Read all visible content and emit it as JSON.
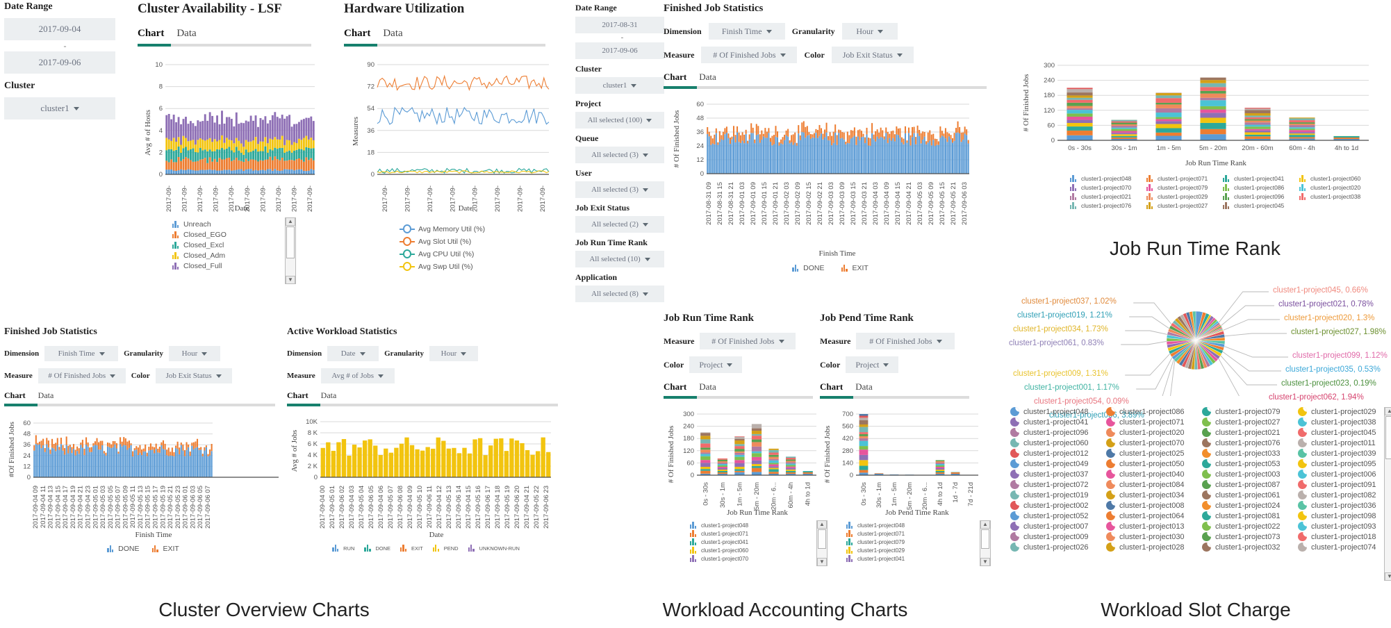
{
  "colors": {
    "accent": "#17806d",
    "blue": "#5b9bd5",
    "orange": "#ed7d31",
    "teal": "#2ca89a",
    "yellow": "#f2c40f",
    "purple": "#8e6fb5",
    "pink": "#e7559c",
    "control_bg": "#eceff1"
  },
  "cluster_overview": {
    "caption": "Cluster Overview Charts",
    "filters": {
      "date_range_label": "Date Range",
      "date_from": "2017-09-04",
      "date_sep": "-",
      "date_to": "2017-09-06",
      "cluster_label": "Cluster",
      "cluster_value": "cluster1"
    },
    "availability": {
      "title": "Cluster Availability - LSF",
      "tabs": [
        "Chart",
        "Data"
      ],
      "active_tab": "Chart",
      "legend": [
        "Unreach",
        "Closed_EGO",
        "Closed_Excl",
        "Closed_Adm",
        "Closed_Full"
      ]
    },
    "hardware": {
      "title": "Hardware Utilization",
      "tabs": [
        "Chart",
        "Data"
      ],
      "active_tab": "Chart",
      "legend": [
        "Avg Memory Util (%)",
        "Avg Slot Util (%)",
        "Avg CPU Util (%)",
        "Avg Swp Util (%)"
      ]
    },
    "finished_job_statistics": {
      "title": "Finished Job Statistics",
      "dimension_label": "Dimension",
      "dimension_value": "Finish Time",
      "granularity_label": "Granularity",
      "granularity_value": "Hour",
      "measure_label": "Measure",
      "measure_value": "# Of Finished Jobs",
      "color_label": "Color",
      "color_value": "Job Exit Status",
      "tabs": [
        "Chart",
        "Data"
      ],
      "active_tab": "Chart",
      "legend": [
        "DONE",
        "EXIT"
      ]
    },
    "active_workload_statistics": {
      "title": "Active Workload Statistics",
      "dimension_label": "Dimension",
      "dimension_value": "Date",
      "granularity_label": "Granularity",
      "granularity_value": "Hour",
      "measure_label": "Measure",
      "measure_value": "Avg # of Jobs",
      "tabs": [
        "Chart",
        "Data"
      ],
      "active_tab": "Chart",
      "legend": [
        "RUN",
        "DONE",
        "EXIT",
        "PEND",
        "UNKNOWN-RUN"
      ]
    }
  },
  "workload_accounting": {
    "caption": "Workload Accounting Charts",
    "filters": {
      "date_range_label": "Date Range",
      "date_from": "2017-08-31",
      "date_sep": "-",
      "date_to": "2017-09-06",
      "items": [
        {
          "label": "Cluster",
          "value": "cluster1"
        },
        {
          "label": "Project",
          "value": "All selected (100)"
        },
        {
          "label": "Queue",
          "value": "All selected (3)"
        },
        {
          "label": "User",
          "value": "All selected (3)"
        },
        {
          "label": "Job Exit Status",
          "value": "All selected (2)"
        },
        {
          "label": "Job Run Time Rank",
          "value": "All selected (10)"
        },
        {
          "label": "Application",
          "value": "All selected (8)"
        }
      ]
    },
    "finished_job_statistics": {
      "title": "Finished Job Statistics",
      "dimension_label": "Dimension",
      "dimension_value": "Finish Time",
      "granularity_label": "Granularity",
      "granularity_value": "Hour",
      "measure_label": "Measure",
      "measure_value": "# Of Finished Jobs",
      "color_label": "Color",
      "color_value": "Job Exit Status",
      "tabs": [
        "Chart",
        "Data"
      ],
      "active_tab": "Chart",
      "legend": [
        "DONE",
        "EXIT"
      ]
    },
    "run_time_rank": {
      "title": "Job Run Time Rank",
      "measure_label": "Measure",
      "measure_value": "# Of Finished Jobs",
      "color_label": "Color",
      "color_value": "Project",
      "tabs": [
        "Chart",
        "Data"
      ],
      "active_tab": "Chart",
      "legend": [
        "cluster1-project048",
        "cluster1-project071",
        "cluster1-project041",
        "cluster1-project060",
        "cluster1-project070"
      ]
    },
    "pend_time_rank": {
      "title": "Job Pend Time Rank",
      "measure_label": "Measure",
      "measure_value": "# Of Finished Jobs",
      "color_label": "Color",
      "color_value": "Project",
      "tabs": [
        "Chart",
        "Data"
      ],
      "active_tab": "Chart",
      "legend": [
        "cluster1-project048",
        "cluster1-project071",
        "cluster1-project079",
        "cluster1-project029",
        "cluster1-project041"
      ]
    }
  },
  "workload_slot_charge": {
    "caption_top": "Job Run Time Rank",
    "caption": "Workload Slot Charge",
    "legend": [
      "cluster1-project048",
      "cluster1-project071",
      "cluster1-project041",
      "cluster1-project060",
      "cluster1-project070",
      "cluster1-project079",
      "cluster1-project086",
      "cluster1-project020",
      "cluster1-project021",
      "cluster1-project029",
      "cluster1-project096",
      "cluster1-project038",
      "cluster1-project076",
      "cluster1-project027",
      "cluster1-project045"
    ],
    "pie_labels": [
      {
        "text": "cluster1-project045, 0.66%",
        "color": "#f08a7f"
      },
      {
        "text": "cluster1-project021, 0.78%",
        "color": "#7a4f9e"
      },
      {
        "text": "cluster1-project020, 1.3%",
        "color": "#ed9a3a"
      },
      {
        "text": "cluster1-project027, 1.98%",
        "color": "#6b8f2f"
      },
      {
        "text": "cluster1-project099, 1.12%",
        "color": "#e069a8"
      },
      {
        "text": "cluster1-project035, 0.53%",
        "color": "#3aa7d8"
      },
      {
        "text": "cluster1-project023, 0.19%",
        "color": "#4a8f3c"
      },
      {
        "text": "cluster1-project062, 1.94%",
        "color": "#d6436e"
      },
      {
        "text": "cluster1-project037, 1.02%",
        "color": "#e08a3c"
      },
      {
        "text": "cluster1-project019, 1.21%",
        "color": "#2f9fb5"
      },
      {
        "text": "cluster1-project034, 1.73%",
        "color": "#e0b528"
      },
      {
        "text": "cluster1-project061, 0.83%",
        "color": "#8e7fb5"
      },
      {
        "text": "cluster1-project009, 1.31%",
        "color": "#e8c32e"
      },
      {
        "text": "cluster1-project001, 1.17%",
        "color": "#3fb3a2"
      },
      {
        "text": "cluster1-project054, 0.09%",
        "color": "#e8757f"
      },
      {
        "text": "cluster1-project056, 3.89%",
        "color": "#2f9fb5"
      }
    ],
    "legend_grid": [
      [
        "cluster1-project048",
        "cluster1-project086",
        "cluster1-project079",
        "cluster1-project029"
      ],
      [
        "cluster1-project041",
        "cluster1-project071",
        "cluster1-project027",
        "cluster1-project038"
      ],
      [
        "cluster1-project096",
        "cluster1-project020",
        "cluster1-project021",
        "cluster1-project045"
      ],
      [
        "cluster1-project060",
        "cluster1-project070",
        "cluster1-project076",
        "cluster1-project011"
      ],
      [
        "cluster1-project012",
        "cluster1-project025",
        "cluster1-project033",
        "cluster1-project039"
      ],
      [
        "cluster1-project049",
        "cluster1-project050",
        "cluster1-project053",
        "cluster1-project095"
      ],
      [
        "cluster1-project037",
        "cluster1-project040",
        "cluster1-project003",
        "cluster1-project006"
      ],
      [
        "cluster1-project072",
        "cluster1-project084",
        "cluster1-project087",
        "cluster1-project091"
      ],
      [
        "cluster1-project019",
        "cluster1-project034",
        "cluster1-project061",
        "cluster1-project082"
      ],
      [
        "cluster1-project002",
        "cluster1-project008",
        "cluster1-project024",
        "cluster1-project036"
      ],
      [
        "cluster1-project052",
        "cluster1-project064",
        "cluster1-project081",
        "cluster1-project098"
      ],
      [
        "cluster1-project007",
        "cluster1-project013",
        "cluster1-project022",
        "cluster1-project093"
      ],
      [
        "cluster1-project009",
        "cluster1-project030",
        "cluster1-project073",
        "cluster1-project018"
      ],
      [
        "cluster1-project026",
        "cluster1-project028",
        "cluster1-project032",
        "cluster1-project074"
      ]
    ]
  },
  "chart_data": [
    {
      "id": "cluster_availability",
      "type": "bar",
      "title": "Cluster Availability - LSF",
      "xlabel": "Date",
      "ylabel": "Avg # of Hosts",
      "ylim": [
        0,
        10
      ],
      "yticks": [
        0,
        2,
        4,
        6,
        8,
        10
      ],
      "grid": true,
      "stacked": true,
      "categories": [
        "2017-09-",
        "2017-09-",
        "2017-09-",
        "2017-09-",
        "2017-09-",
        "2017-09-",
        "2017-09-",
        "2017-09-",
        "2017-09-",
        "2017-09-"
      ],
      "series": [
        {
          "name": "Unreach",
          "color": "#5b9bd5",
          "values": [
            0.4,
            0.4,
            0.4,
            0.4,
            0.4,
            0.4,
            0.4,
            0.4,
            0.4,
            0.4
          ]
        },
        {
          "name": "Closed_EGO",
          "color": "#ed7d31",
          "values": [
            0.9,
            0.8,
            1.0,
            0.9,
            0.8,
            1.0,
            0.9,
            0.8,
            1.0,
            0.9
          ]
        },
        {
          "name": "Closed_Excl",
          "color": "#2ca89a",
          "values": [
            0.9,
            1.0,
            0.8,
            0.9,
            1.0,
            0.8,
            0.9,
            1.0,
            0.8,
            0.9
          ]
        },
        {
          "name": "Closed_Adm",
          "color": "#f2c40f",
          "values": [
            0.9,
            0.8,
            0.9,
            1.0,
            0.8,
            0.9,
            0.8,
            1.0,
            0.9,
            0.8
          ]
        },
        {
          "name": "Closed_Full",
          "color": "#8e6fb5",
          "values": [
            1.9,
            2.0,
            1.9,
            1.8,
            2.0,
            1.9,
            2.0,
            1.8,
            1.9,
            2.0
          ]
        }
      ]
    },
    {
      "id": "hardware_utilization",
      "type": "line",
      "title": "Hardware Utilization",
      "xlabel": "Date",
      "ylabel": "Measures",
      "ylim": [
        0,
        90
      ],
      "yticks": [
        0,
        18,
        36,
        54,
        72,
        90
      ],
      "grid": true,
      "series": [
        {
          "name": "Avg Memory Util (%)",
          "color": "#5b9bd5",
          "mean": 48,
          "amp": 7
        },
        {
          "name": "Avg Slot Util (%)",
          "color": "#ed7d31",
          "mean": 75,
          "amp": 6
        },
        {
          "name": "Avg CPU Util (%)",
          "color": "#2ca89a",
          "mean": 3,
          "amp": 2
        },
        {
          "name": "Avg Swp Util (%)",
          "color": "#f2c40f",
          "mean": 2,
          "amp": 1
        }
      ]
    },
    {
      "id": "finished_job_statistics_left",
      "type": "bar",
      "stacked": true,
      "xlabel": "Finish Time",
      "ylabel": "# Of Finished Jobs",
      "ylim": [
        0,
        60
      ],
      "yticks": [
        0,
        12,
        24,
        36,
        48,
        60
      ],
      "grid": true,
      "series": [
        {
          "name": "DONE",
          "color": "#5b9bd5",
          "mean": 30,
          "amp": 7
        },
        {
          "name": "EXIT",
          "color": "#ed7d31",
          "mean": 6,
          "amp": 4
        }
      ],
      "xticks": [
        "2017-09-04 09",
        "2017-09-04 11",
        "2017-09-04 13",
        "2017-09-04 15",
        "2017-09-04 17",
        "2017-09-04 19",
        "2017-09-04 21",
        "2017-09-04 23",
        "2017-09-05 01",
        "2017-09-05 03",
        "2017-09-05 05",
        "2017-09-05 07",
        "2017-09-05 09",
        "2017-09-05 11",
        "2017-09-05 13",
        "2017-09-05 15",
        "2017-09-05 17",
        "2017-09-05 19",
        "2017-09-05 21",
        "2017-09-05 23",
        "2017-09-06 01",
        "2017-09-06 03",
        "2017-09-06 05",
        "2017-09-06 07"
      ]
    },
    {
      "id": "active_workload_statistics",
      "type": "bar",
      "xlabel": "Date",
      "ylabel": "Avg # of Jobs",
      "ylim": [
        0,
        10000
      ],
      "yticks": [
        "0",
        "2 K",
        "4 K",
        "6 K",
        "8 K",
        "10K"
      ],
      "grid": true,
      "series": [
        {
          "name": "RUN",
          "color": "#f2c40f",
          "mean": 5500,
          "amp": 1800
        }
      ]
    },
    {
      "id": "finished_job_statistics_mid",
      "type": "bar",
      "stacked": true,
      "xlabel": "Finish Time",
      "ylabel": "# Of Finished Jobs",
      "ylim": [
        0,
        60
      ],
      "yticks": [
        0,
        12,
        24,
        36,
        48,
        60
      ],
      "grid": true,
      "series": [
        {
          "name": "DONE",
          "color": "#5b9bd5",
          "mean": 30,
          "amp": 6
        },
        {
          "name": "EXIT",
          "color": "#ed7d31",
          "mean": 6,
          "amp": 4
        }
      ],
      "xticks": [
        "2017-08-31 09",
        "2017-08-31 15",
        "2017-08-31 21",
        "2017-09-01 03",
        "2017-09-01 09",
        "2017-09-01 15",
        "2017-09-01 21",
        "2017-09-02 03",
        "2017-09-02 09",
        "2017-09-02 15",
        "2017-09-02 21",
        "2017-09-03 03",
        "2017-09-03 09",
        "2017-09-03 15",
        "2017-09-03 21",
        "2017-09-04 03",
        "2017-09-04 09",
        "2017-09-04 15",
        "2017-09-04 21",
        "2017-09-05 03",
        "2017-09-05 09",
        "2017-09-05 15",
        "2017-09-05 21",
        "2017-09-06 03"
      ]
    },
    {
      "id": "job_run_time_rank_mid",
      "type": "bar",
      "stacked": true,
      "xlabel": "Job Run Time Rank",
      "ylabel": "# Of Finished Jobs",
      "ylim": [
        0,
        300
      ],
      "yticks": [
        0,
        60,
        120,
        180,
        240,
        300
      ],
      "grid": true,
      "categories": [
        "0s - 30s",
        "30s - 1m",
        "1m - 5m",
        "5m - 20m",
        "20m - 6...",
        "60m - 4h",
        "4h to 1d"
      ],
      "values": [
        210,
        82,
        190,
        251,
        130,
        91,
        20
      ]
    },
    {
      "id": "job_pend_time_rank_mid",
      "type": "bar",
      "stacked": true,
      "xlabel": "Job Pend Time Rank",
      "ylabel": "# Of Finished Jobs",
      "ylim": [
        0,
        700
      ],
      "yticks": [
        0,
        140,
        280,
        420,
        560,
        700
      ],
      "grid": true,
      "categories": [
        "0s - 30s",
        "30s - 1m",
        "1m - 5m",
        "5m - 20m",
        "20m - 6...",
        "4h to 1d",
        "1d - 7d",
        "7d - 21d"
      ],
      "values": [
        700,
        22,
        8,
        6,
        4,
        172,
        35,
        0
      ]
    },
    {
      "id": "job_run_time_rank_right",
      "type": "bar",
      "stacked": true,
      "title": "Job Run Time Rank",
      "xlabel": "Job Run Time Rank",
      "ylabel": "# Of Finished Jobs",
      "ylim": [
        0,
        300
      ],
      "yticks": [
        0,
        60,
        120,
        180,
        240,
        300
      ],
      "grid": true,
      "categories": [
        "0s - 30s",
        "30s - 1m",
        "1m - 5m",
        "5m - 20m",
        "20m - 60m",
        "60m - 4h",
        "4h to 1d"
      ],
      "values": [
        210,
        82,
        190,
        251,
        130,
        91,
        17
      ],
      "legend": [
        "cluster1-project048",
        "cluster1-project071",
        "cluster1-project041",
        "cluster1-project060",
        "cluster1-project070",
        "cluster1-project079",
        "cluster1-project086",
        "cluster1-project020",
        "cluster1-project021",
        "cluster1-project029",
        "cluster1-project096",
        "cluster1-project038",
        "cluster1-project076",
        "cluster1-project027",
        "cluster1-project045"
      ]
    },
    {
      "id": "workload_slot_charge_pie",
      "type": "pie",
      "title": "Workload Slot Charge",
      "labels": [
        "cluster1-project056",
        "cluster1-project027",
        "cluster1-project062",
        "cluster1-project099",
        "cluster1-project034",
        "cluster1-project020",
        "cluster1-project009",
        "cluster1-project019",
        "cluster1-project001",
        "cluster1-project037",
        "cluster1-project061",
        "cluster1-project021",
        "cluster1-project045",
        "cluster1-project035",
        "cluster1-project023",
        "cluster1-project054"
      ],
      "values": [
        3.89,
        1.98,
        1.94,
        1.12,
        1.73,
        1.3,
        1.31,
        1.21,
        1.17,
        1.02,
        0.83,
        0.78,
        0.66,
        0.53,
        0.19,
        0.09
      ]
    }
  ]
}
